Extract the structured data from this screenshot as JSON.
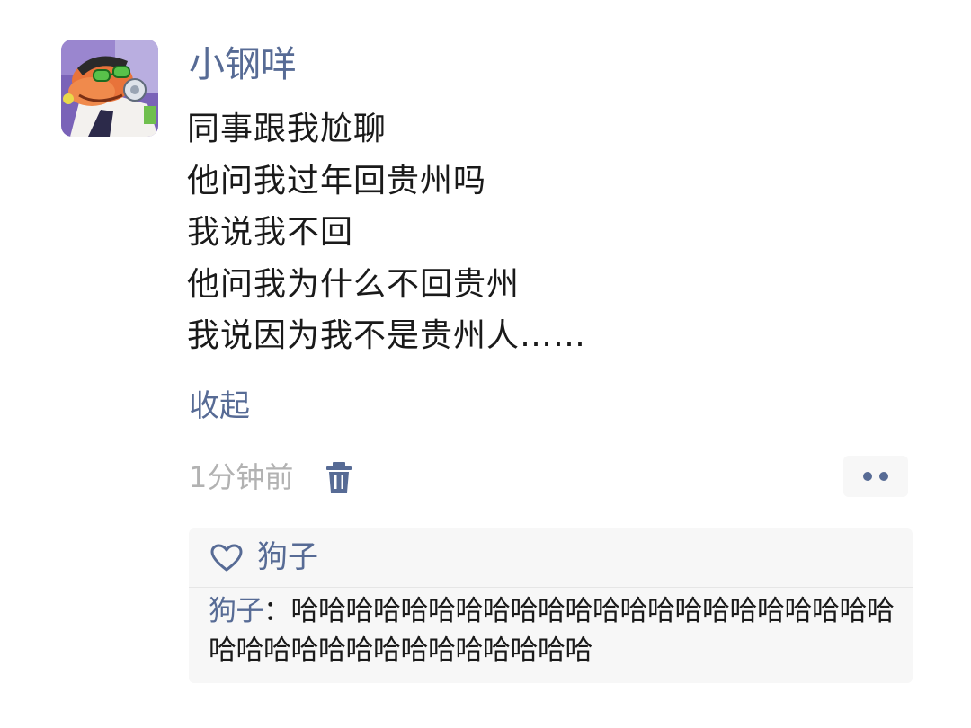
{
  "post": {
    "author": "小钢咩",
    "lines": [
      "同事跟我尬聊",
      "他问我过年回贵州吗",
      "我说我不回",
      "他问我为什么不回贵州",
      "我说因为我不是贵州人……"
    ],
    "collapse_label": "收起",
    "timestamp": "1分钟前"
  },
  "icons": {
    "delete": "trash-icon",
    "more": "more-dots-icon",
    "like": "heart-outline-icon"
  },
  "interactions": {
    "likes": [
      "狗子"
    ],
    "comments": [
      {
        "author": "狗子",
        "separator": "：",
        "text": "哈哈哈哈哈哈哈哈哈哈哈哈哈哈哈哈哈哈哈哈哈哈哈哈哈哈哈哈哈哈哈哈哈哈哈哈"
      }
    ]
  },
  "colors": {
    "link": "#576b95",
    "text": "#1a1a1a",
    "muted": "#b2b2b2",
    "panel_bg": "#f7f7f7"
  }
}
